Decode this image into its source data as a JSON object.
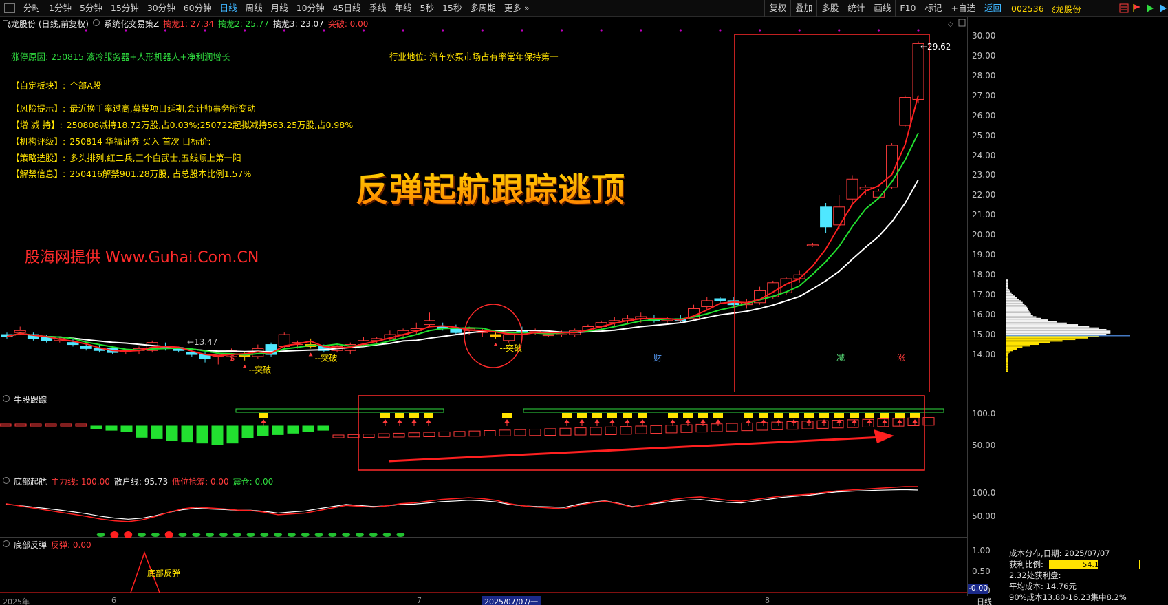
{
  "toolbar": {
    "periods": [
      "分时",
      "1分钟",
      "5分钟",
      "15分钟",
      "30分钟",
      "60分钟",
      "日线",
      "周线",
      "月线",
      "10分钟",
      "45日线",
      "季线",
      "年线",
      "5秒",
      "15秒",
      "多周期",
      "更多 »"
    ],
    "active": "日线",
    "right": [
      "复权",
      "叠加",
      "多股",
      "统计",
      "画线",
      "F10",
      "标记",
      "+自选",
      "返回"
    ],
    "symbol_code": "002536",
    "symbol_name": "飞龙股份"
  },
  "main_header": {
    "stock": "飞龙股份 (日线,前复权)",
    "system": "系统化交易策Z",
    "qinlong1_label": "擒龙1: 27.34",
    "qinlong2_label": "擒龙2: 25.77",
    "qinlong3_label": "擒龙3: 23.07",
    "break_label": "突破: 0.00"
  },
  "info": {
    "reason": "涨停原因: 250815 液冷服务器+人形机器人+净利润增长",
    "industry": "行业地位: 汽车水泵市场占有率常年保持第一",
    "rows": [
      {
        "tag": "【自定板块】:",
        "text": "全部A股"
      },
      {
        "tag": "【风险提示】:",
        "text": "最近换手率过高,募投项目延期,会计师事务所变动"
      },
      {
        "tag": "【增 减 持】:",
        "text": "250808减持18.72万股,占0.03%;250722起拟减持563.25万股,占0.98%"
      },
      {
        "tag": "【机构评级】:",
        "text": "250814 华福证券 买入 首次 目标价:--"
      },
      {
        "tag": "【策略选股】:",
        "text": "多头排列,红二兵,三个白武士,五线顺上第一阳"
      },
      {
        "tag": "【解禁信息】:",
        "text": "250416解禁901.28万股, 占总股本比例1.57%"
      }
    ],
    "big_title": "反弹起航跟踪逃顶",
    "watermark": "股海网提供 Www.Guhai.Com.CN"
  },
  "main_axis": [
    "30.00",
    "29.00",
    "28.00",
    "27.00",
    "26.00",
    "25.00",
    "24.00",
    "23.00",
    "22.00",
    "21.00",
    "20.00",
    "19.00",
    "18.00",
    "17.00",
    "16.00",
    "15.00",
    "14.00"
  ],
  "annotations": {
    "low": "←13.47",
    "high": "←29.62",
    "breakouts": [
      "--突破",
      "--突破",
      "--突破"
    ],
    "events": [
      "$",
      "财",
      "减",
      "涨"
    ]
  },
  "panel_bull": {
    "title": "牛股跟踪",
    "axis": [
      "100.0",
      "50.00"
    ]
  },
  "panel_bottom": {
    "title": "底部起航",
    "main": "主力线: 100.00",
    "retail": "散户线: 95.73",
    "low_grab": "低位抢筹: 0.00",
    "shake": "震仓: 0.00",
    "axis": [
      "100.0",
      "50.00"
    ]
  },
  "panel_rebound": {
    "title": "底部反弹",
    "value": "反弹: 0.00",
    "label": "底部反弹",
    "axis": [
      "1.00",
      "0.50",
      "0.00",
      "-0.00"
    ]
  },
  "xaxis": {
    "labels": [
      "2025年",
      "6",
      "7",
      "2025/07/07/一",
      "8"
    ],
    "dayline": "日线"
  },
  "cost": {
    "title": "成本分布,日期: 2025/07/07",
    "profit_label": "获利比例:",
    "profit_value": "54.1%",
    "profit_ratio": 0.541,
    "line2": "2.32处获利盘:",
    "avg": "平均成本: 14.76元",
    "concentration": "90%成本13.80-16.23集中8.2%"
  },
  "chart_data": {
    "type": "candlestick",
    "ylim": [
      13.0,
      30.2
    ],
    "ohlc": [
      [
        15.0,
        15.1,
        14.8,
        14.9
      ],
      [
        15.1,
        15.4,
        15.0,
        15.2
      ],
      [
        15.0,
        15.1,
        14.7,
        14.8
      ],
      [
        14.9,
        15.0,
        14.6,
        14.7
      ],
      [
        14.7,
        14.9,
        14.6,
        14.8
      ],
      [
        14.6,
        14.8,
        14.4,
        14.5
      ],
      [
        14.4,
        14.6,
        14.2,
        14.3
      ],
      [
        14.3,
        14.5,
        14.1,
        14.2
      ],
      [
        14.3,
        14.4,
        14.0,
        14.1
      ],
      [
        14.2,
        14.3,
        14.0,
        14.2
      ],
      [
        14.2,
        14.4,
        14.0,
        14.3
      ],
      [
        14.2,
        14.7,
        14.1,
        14.6
      ],
      [
        14.4,
        14.6,
        14.2,
        14.3
      ],
      [
        14.3,
        14.4,
        14.1,
        14.2
      ],
      [
        14.1,
        14.2,
        13.9,
        14.0
      ],
      [
        14.0,
        14.1,
        13.6,
        13.8
      ],
      [
        13.9,
        14.1,
        13.5,
        14.0
      ],
      [
        13.9,
        14.3,
        13.7,
        14.2
      ],
      [
        14.0,
        14.1,
        13.7,
        13.9
      ],
      [
        13.9,
        14.5,
        13.8,
        14.3
      ],
      [
        14.5,
        14.6,
        13.9,
        14.0
      ],
      [
        14.4,
        15.1,
        14.3,
        15.0
      ],
      [
        14.5,
        14.7,
        14.3,
        14.6
      ],
      [
        14.5,
        14.8,
        14.3,
        14.4
      ],
      [
        14.4,
        14.5,
        14.1,
        14.2
      ],
      [
        14.2,
        14.5,
        14.1,
        14.4
      ],
      [
        14.2,
        14.6,
        14.0,
        14.5
      ],
      [
        14.5,
        14.9,
        14.4,
        14.7
      ],
      [
        14.7,
        14.9,
        14.5,
        14.8
      ],
      [
        14.8,
        15.2,
        14.7,
        15.0
      ],
      [
        15.0,
        15.3,
        14.8,
        15.2
      ],
      [
        15.2,
        15.6,
        15.0,
        15.3
      ],
      [
        15.5,
        16.1,
        15.4,
        15.7
      ],
      [
        15.4,
        15.6,
        15.2,
        15.3
      ],
      [
        15.3,
        15.5,
        15.0,
        15.1
      ],
      [
        15.2,
        15.4,
        15.0,
        15.3
      ],
      [
        15.1,
        15.3,
        14.9,
        15.2
      ],
      [
        15.0,
        15.1,
        14.8,
        14.9
      ],
      [
        14.7,
        15.1,
        14.6,
        15.0
      ],
      [
        15.2,
        15.4,
        15.0,
        15.1
      ],
      [
        15.2,
        15.3,
        15.0,
        15.2
      ],
      [
        15.0,
        15.1,
        14.9,
        15.0
      ],
      [
        15.0,
        15.2,
        14.9,
        15.1
      ],
      [
        15.0,
        15.3,
        14.9,
        15.2
      ],
      [
        15.2,
        15.5,
        15.1,
        15.4
      ],
      [
        15.4,
        15.7,
        15.3,
        15.6
      ],
      [
        15.6,
        15.9,
        15.4,
        15.7
      ],
      [
        15.7,
        16.0,
        15.5,
        15.8
      ],
      [
        15.8,
        16.1,
        15.6,
        15.9
      ],
      [
        15.8,
        16.0,
        15.6,
        15.7
      ],
      [
        15.7,
        15.9,
        15.6,
        15.8
      ],
      [
        15.8,
        16.0,
        15.6,
        15.7
      ],
      [
        15.8,
        16.5,
        15.7,
        16.3
      ],
      [
        16.4,
        16.9,
        16.2,
        16.7
      ],
      [
        16.8,
        16.9,
        16.6,
        16.7
      ],
      [
        16.7,
        16.9,
        16.4,
        16.5
      ],
      [
        16.5,
        16.8,
        16.3,
        16.6
      ],
      [
        16.6,
        17.4,
        16.5,
        17.2
      ],
      [
        16.9,
        17.7,
        16.8,
        17.6
      ],
      [
        17.1,
        17.9,
        17.0,
        17.8
      ],
      [
        17.8,
        18.2,
        17.6,
        18.0
      ],
      [
        19.5,
        19.6,
        19.4,
        19.5
      ],
      [
        21.4,
        21.6,
        20.1,
        20.4
      ],
      [
        20.5,
        22.0,
        20.3,
        21.4
      ],
      [
        21.8,
        23.0,
        21.6,
        22.8
      ],
      [
        22.3,
        22.5,
        22.0,
        22.4
      ],
      [
        21.9,
        22.3,
        21.8,
        22.2
      ],
      [
        22.4,
        24.6,
        22.3,
        24.5
      ],
      [
        25.5,
        27.0,
        25.4,
        26.9
      ],
      [
        26.8,
        29.7,
        26.6,
        29.6
      ]
    ],
    "ma_red_end": 27.34,
    "ma_green_end": 25.77,
    "ma_white_end": 23.07
  }
}
